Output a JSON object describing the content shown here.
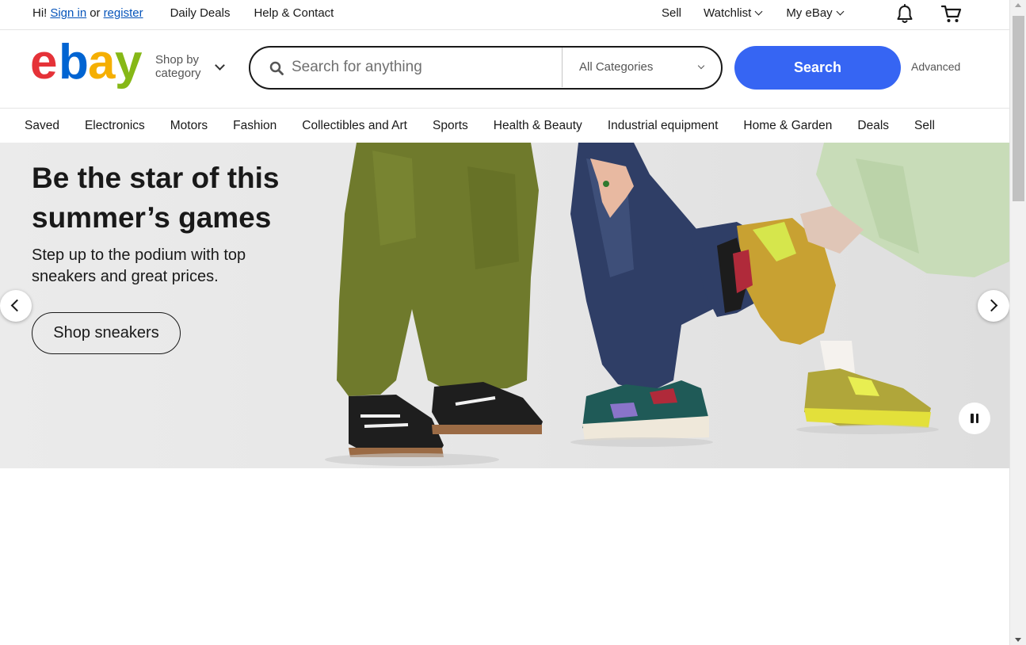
{
  "topbar": {
    "greeting": "Hi!",
    "sign_in": "Sign in",
    "or": "or",
    "register": "register",
    "daily_deals": "Daily Deals",
    "help_contact": "Help & Contact",
    "sell": "Sell",
    "watchlist": "Watchlist",
    "my_ebay": "My eBay",
    "notification_icon": "bell-icon",
    "cart_icon": "cart-icon"
  },
  "header": {
    "logo_letters": [
      "e",
      "b",
      "a",
      "y"
    ],
    "logo_colors": [
      "#e53238",
      "#0064d2",
      "#f5af02",
      "#86b817"
    ],
    "shop_by": "Shop by",
    "category": "category",
    "search_placeholder": "Search for anything",
    "category_select": "All Categories",
    "search_button": "Search",
    "advanced": "Advanced",
    "accent": "#3665f3"
  },
  "nav": {
    "items": [
      "Saved",
      "Electronics",
      "Motors",
      "Fashion",
      "Collectibles and Art",
      "Sports",
      "Health & Beauty",
      "Industrial equipment",
      "Home & Garden",
      "Deals",
      "Sell"
    ]
  },
  "hero": {
    "title": "Be the star of this summer’s games",
    "subtitle": "Step up to the podium with top sneakers and great prices.",
    "cta": "Shop sneakers",
    "prev_icon": "chevron-left-icon",
    "next_icon": "chevron-right-icon",
    "pause_icon": "pause-icon"
  }
}
